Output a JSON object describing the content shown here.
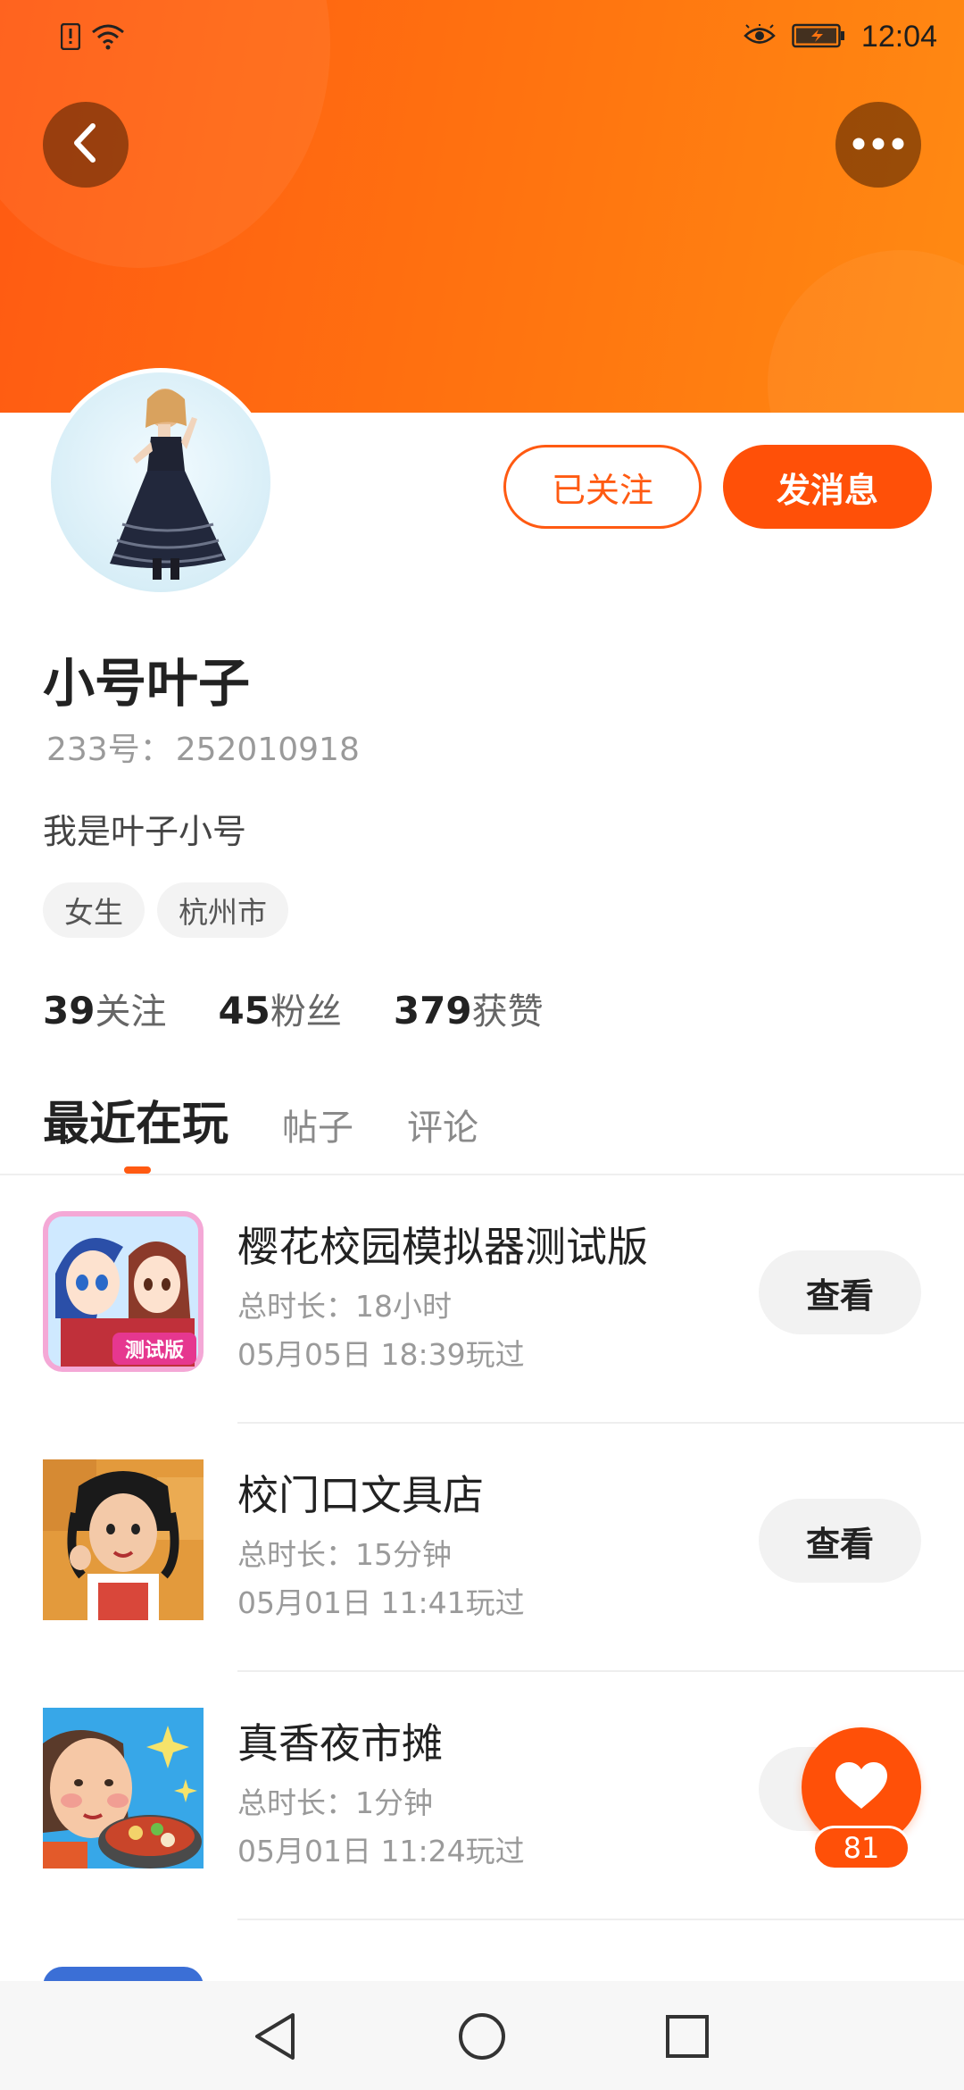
{
  "status_bar": {
    "time": "12:04",
    "left_icons": [
      "sim-alert-icon",
      "wifi-icon"
    ],
    "right_icons": [
      "eye-comfort-icon",
      "battery-charging-icon"
    ]
  },
  "header": {
    "back_icon": "chevron-left-icon",
    "more_icon": "more-horizontal-icon",
    "banner_color": "#ff6a10"
  },
  "profile": {
    "followed_label": "已关注",
    "message_label": "发消息",
    "nickname": "小号叶子",
    "id_label": "233号：",
    "id_value": "252010918",
    "bio": "我是叶子小号",
    "tags": [
      "女生",
      "杭州市"
    ],
    "stats": [
      {
        "num": "39",
        "label": "关注"
      },
      {
        "num": "45",
        "label": "粉丝"
      },
      {
        "num": "379",
        "label": "获赞"
      }
    ]
  },
  "tabs": [
    {
      "label": "最近在玩",
      "active": true
    },
    {
      "label": "帖子",
      "active": false
    },
    {
      "label": "评论",
      "active": false
    }
  ],
  "games": [
    {
      "title": "樱花校园模拟器测试版",
      "duration": "总时长：18小时",
      "played": "05月05日 18:39玩过",
      "button": "查看",
      "icon_badge": "测试版"
    },
    {
      "title": "校门口文具店",
      "duration": "总时长：15分钟",
      "played": "05月01日 11:41玩过",
      "button": "查看"
    },
    {
      "title": "真香夜市摊",
      "duration": "总时长：1分钟",
      "played": "05月01日 11:24玩过",
      "button": "查看"
    }
  ],
  "like": {
    "icon": "heart-icon",
    "count": "81"
  },
  "nav": {
    "icons": [
      "nav-back-icon",
      "nav-home-icon",
      "nav-recents-icon"
    ]
  },
  "colors": {
    "accent": "#ff5008",
    "muted_text": "#9a9a9a"
  }
}
